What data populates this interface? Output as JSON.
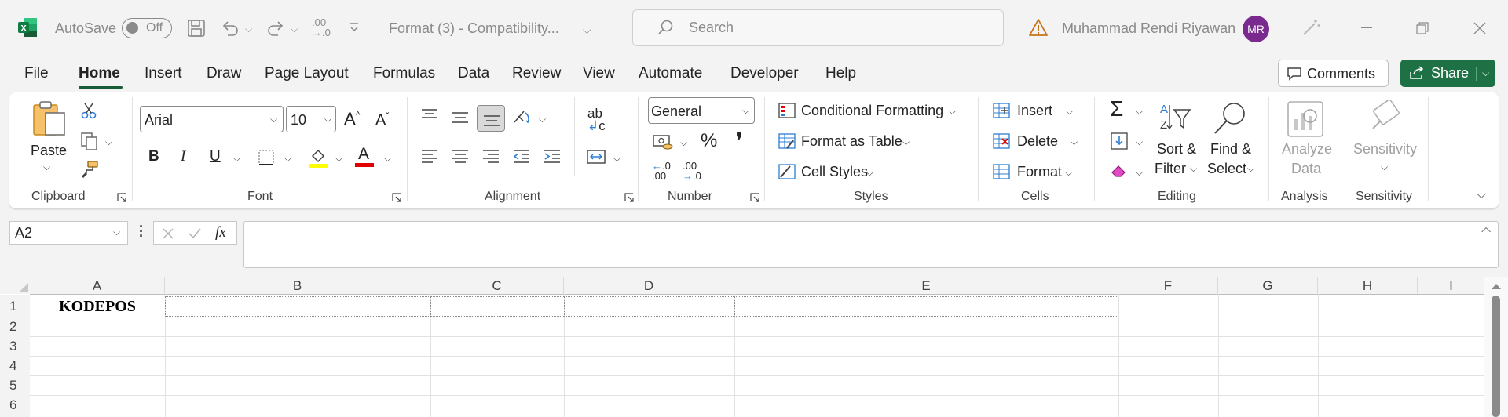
{
  "titlebar": {
    "autosave_label": "AutoSave",
    "autosave_state": "Off",
    "doc_title": "Format (3)  -  Compatibility...",
    "search_placeholder": "Search",
    "user_name": "Muhammad Rendi Riyawan",
    "user_initials": "MR"
  },
  "menu": {
    "tabs": [
      "File",
      "Home",
      "Insert",
      "Draw",
      "Page Layout",
      "Formulas",
      "Data",
      "Review",
      "View",
      "Automate",
      "Developer",
      "Help"
    ],
    "active": "Home",
    "comments_label": "Comments",
    "share_label": "Share"
  },
  "ribbon": {
    "clipboard": {
      "paste": "Paste",
      "label": "Clipboard"
    },
    "font": {
      "name": "Arial",
      "size": "10",
      "bold": "B",
      "italic": "I",
      "underline": "U",
      "label": "Font",
      "highlight_color": "#ffff00",
      "font_color": "#e00000"
    },
    "alignment": {
      "label": "Alignment"
    },
    "number": {
      "format": "General",
      "label": "Number",
      "percent": "%",
      "comma": "❜"
    },
    "styles": {
      "conditional": "Conditional Formatting",
      "table": "Format as Table",
      "cell_styles": "Cell Styles",
      "label": "Styles"
    },
    "cells": {
      "insert": "Insert",
      "delete": "Delete",
      "format": "Format",
      "label": "Cells"
    },
    "editing": {
      "sort": "Sort &",
      "sort2": "Filter",
      "find": "Find &",
      "find2": "Select",
      "label": "Editing"
    },
    "analysis": {
      "analyze": "Analyze",
      "analyze2": "Data",
      "label": "Analysis"
    },
    "sensitivity": {
      "button": "Sensitivity",
      "label": "Sensitivity"
    }
  },
  "formula_bar": {
    "name_box": "A2",
    "fx": "fx",
    "formula": ""
  },
  "sheet": {
    "columns": [
      "A",
      "B",
      "C",
      "D",
      "E",
      "F",
      "G",
      "H",
      "I"
    ],
    "rows": [
      "1",
      "2",
      "3",
      "4",
      "5",
      "6"
    ],
    "cells": {
      "A1": "KODEPOS"
    }
  },
  "colors": {
    "accent": "#1e7145",
    "excel_green": "#107c41",
    "avatar": "#7a2a8f"
  }
}
